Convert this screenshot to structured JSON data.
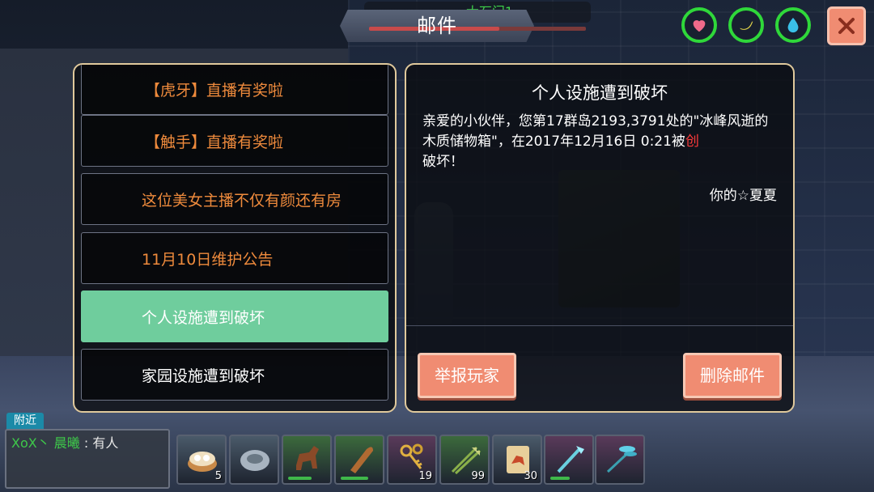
{
  "header": {
    "title": "邮件",
    "location": "大石门1",
    "progress": 0.6
  },
  "stats": {
    "health_icon": "heart-icon",
    "food_icon": "banana-icon",
    "water_icon": "water-drop-icon",
    "ring_color": "#2fd83a"
  },
  "close_icon": "close-icon",
  "mail_list": [
    {
      "label": "【虎牙】直播有奖啦",
      "color": "#ee8a3c"
    },
    {
      "label": "【触手】直播有奖啦",
      "color": "#ee8a3c"
    },
    {
      "label": "这位美女主播不仅有颜还有房",
      "color": "#ee8a3c"
    },
    {
      "label": "11月10日维护公告",
      "color": "#ee8a3c"
    },
    {
      "label": "个人设施遭到破坏",
      "color": "#ffffff",
      "selected": true
    },
    {
      "label": "家园设施遭到破坏",
      "color": "#ffffff"
    }
  ],
  "detail": {
    "title": "个人设施遭到破坏",
    "body_before": "亲爱的小伙伴，您第17群岛2193,3791处的\"冰峰风逝的木质储物箱\"，在2017年12月16日 0:21被",
    "body_highlight": "创",
    "body_after": "破坏！",
    "signature": "你的☆夏夏",
    "report_button": "举报玩家",
    "delete_button": "删除邮件"
  },
  "chat": {
    "tab": "附近",
    "sender": "XoX丶 晨曦",
    "separator": " : ",
    "message": "有人"
  },
  "hotbar": [
    {
      "icon": "dumpling-steamer-icon",
      "count": "5",
      "bg": "#4a5a6a"
    },
    {
      "icon": "stone-disc-icon",
      "count": "",
      "bg": "#4a5a6a"
    },
    {
      "icon": "horse-icon",
      "count": "",
      "bg": "#3c6a3c",
      "durability": 0.6
    },
    {
      "icon": "wooden-club-icon",
      "count": "",
      "bg": "#3c6a3c",
      "durability": 0.7
    },
    {
      "icon": "keys-icon",
      "count": "19",
      "bg": "#5a3a5a"
    },
    {
      "icon": "arrows-icon",
      "count": "99",
      "bg": "#3c6a3c"
    },
    {
      "icon": "dino-feed-bag-icon",
      "count": "30",
      "bg": "#4a5a6a"
    },
    {
      "icon": "crystal-staff-icon",
      "count": "",
      "bg": "#5a3a5a",
      "durability": 0.5
    },
    {
      "icon": "dragonfly-icon",
      "count": "",
      "bg": "#5a3a5a"
    }
  ]
}
